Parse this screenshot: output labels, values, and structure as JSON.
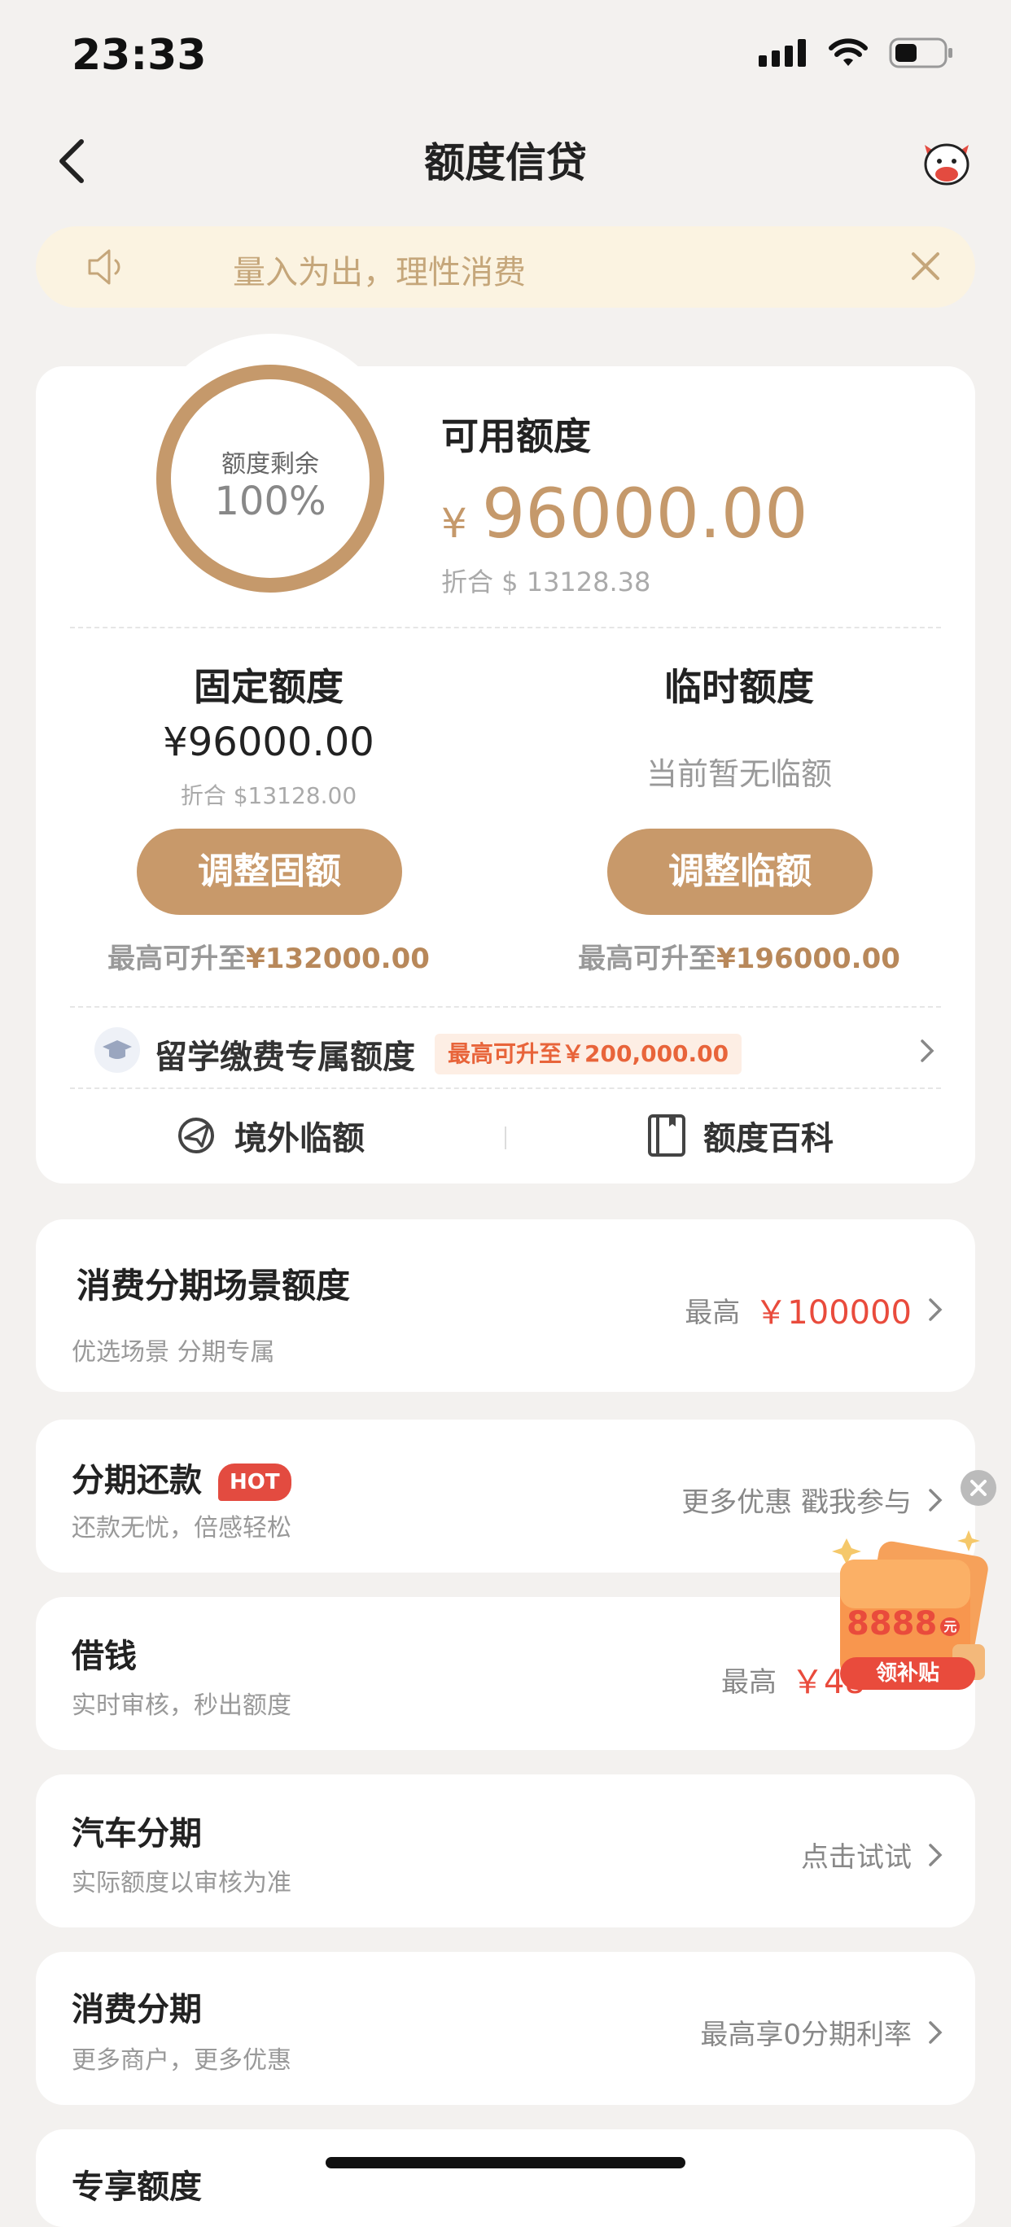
{
  "status_bar": {
    "time": "23:33"
  },
  "nav": {
    "title": "额度信贷"
  },
  "notice": {
    "text": "量入为出，理性消费"
  },
  "summary": {
    "ring_label": "额度剩余",
    "ring_percent": "100%",
    "available_label": "可用额度",
    "currency": "¥",
    "available_amount": "96000.00",
    "available_converted": "折合 $ 13128.38"
  },
  "fixed": {
    "title": "固定额度",
    "amount": "¥96000.00",
    "converted": "折合 $13128.00",
    "button": "调整固额",
    "limit_prefix": "最高可升至",
    "limit_value": "¥132000.00"
  },
  "temporary": {
    "title": "临时额度",
    "status": "当前暂无临额",
    "button": "调整临额",
    "limit_prefix": "最高可升至",
    "limit_value": "¥196000.00"
  },
  "study_abroad": {
    "label": "留学缴费专属额度",
    "badge": "最高可升至￥200,000.00"
  },
  "links": {
    "overseas": "境外临额",
    "wiki": "额度百科"
  },
  "rows": [
    {
      "title": "消费分期场景额度",
      "subtitle": "优选场景 分期专属",
      "right_prefix": "最高",
      "right_value": "￥100000"
    },
    {
      "title": "分期还款",
      "badge": "HOT",
      "subtitle": "还款无忧，倍感轻松",
      "right_text": "更多优惠 戳我参与"
    },
    {
      "title": "借钱",
      "subtitle": "实时审核，秒出额度",
      "right_prefix": "最高",
      "right_value": "￥48"
    },
    {
      "title": "汽车分期",
      "subtitle": "实际额度以审核为准",
      "right_text": "点击试试"
    },
    {
      "title": "消费分期",
      "subtitle": "更多商户，更多优惠",
      "right_text": "最高享0分期利率"
    },
    {
      "title": "专享额度"
    }
  ],
  "promo": {
    "amount": "8888",
    "unit": "元",
    "label": "领补贴"
  },
  "colors": {
    "gold": "#c8996a",
    "red": "#e94b3c",
    "notice_bg": "#fbf3e1"
  }
}
